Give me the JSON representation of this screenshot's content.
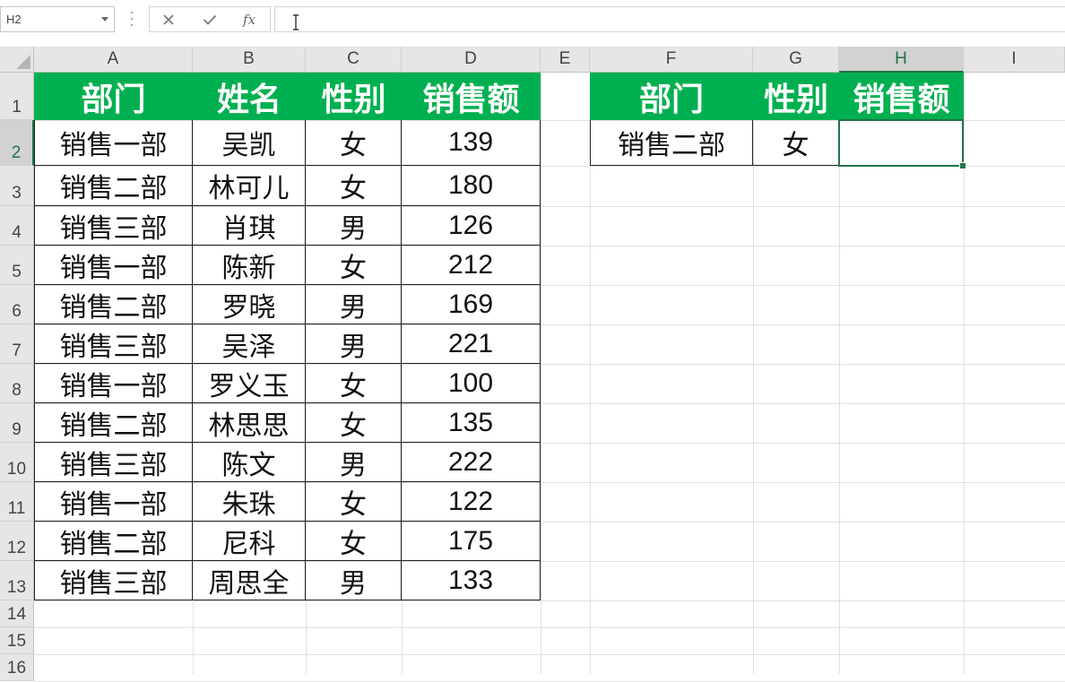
{
  "formula_bar": {
    "name_box": "H2",
    "cancel_icon": "close-icon",
    "enter_icon": "check-icon",
    "fx_label": "fx",
    "formula": ""
  },
  "columns": [
    "A",
    "B",
    "C",
    "D",
    "E",
    "F",
    "G",
    "H",
    "I"
  ],
  "selected_column": "H",
  "rows": [
    "1",
    "2",
    "3",
    "4",
    "5",
    "6",
    "7",
    "8",
    "9",
    "10",
    "11",
    "12",
    "13",
    "14",
    "15",
    "16"
  ],
  "selected_row": "2",
  "table1": {
    "headers": [
      "部门",
      "姓名",
      "性别",
      "销售额"
    ],
    "data": [
      [
        "销售一部",
        "吴凯",
        "女",
        "139"
      ],
      [
        "销售二部",
        "林可儿",
        "女",
        "180"
      ],
      [
        "销售三部",
        "肖琪",
        "男",
        "126"
      ],
      [
        "销售一部",
        "陈新",
        "女",
        "212"
      ],
      [
        "销售二部",
        "罗晓",
        "男",
        "169"
      ],
      [
        "销售三部",
        "吴泽",
        "男",
        "221"
      ],
      [
        "销售一部",
        "罗义玉",
        "女",
        "100"
      ],
      [
        "销售二部",
        "林思思",
        "女",
        "135"
      ],
      [
        "销售三部",
        "陈文",
        "男",
        "222"
      ],
      [
        "销售一部",
        "朱珠",
        "女",
        "122"
      ],
      [
        "销售二部",
        "尼科",
        "女",
        "175"
      ],
      [
        "销售三部",
        "周思全",
        "男",
        "133"
      ]
    ]
  },
  "table2": {
    "headers": [
      "部门",
      "性别",
      "销售额"
    ],
    "data": [
      [
        "销售二部",
        "女",
        ""
      ]
    ]
  },
  "colors": {
    "header_fill": "#00b050",
    "selection_accent": "#217346"
  }
}
